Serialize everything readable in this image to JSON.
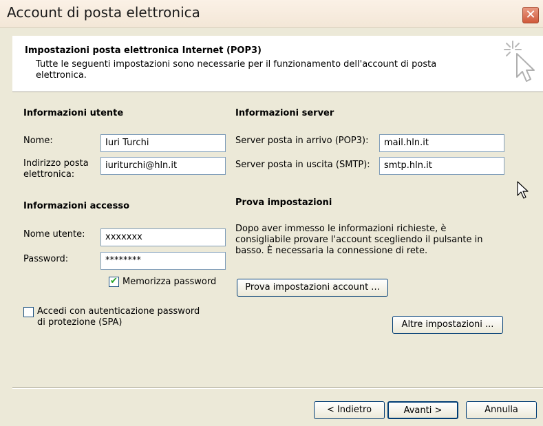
{
  "window": {
    "title": "Account di posta elettronica",
    "close_glyph": "✕"
  },
  "header": {
    "title": "Impostazioni posta elettronica Internet (POP3)",
    "description": "Tutte le seguenti impostazioni sono necessarie per il funzionamento dell'account di posta elettronica.",
    "icon": "wizard-cursor-icon"
  },
  "user_info": {
    "section_title": "Informazioni utente",
    "name_label": "Nome:",
    "name_value": "Iuri Turchi",
    "email_label": "Indirizzo posta elettronica:",
    "email_value": "iuriturchi@hln.it"
  },
  "server_info": {
    "section_title": "Informazioni server",
    "incoming_label": "Server posta in arrivo (POP3):",
    "incoming_value": "mail.hln.it",
    "outgoing_label": "Server posta in uscita (SMTP):",
    "outgoing_value": "smtp.hln.it"
  },
  "login_info": {
    "section_title": "Informazioni accesso",
    "username_label": "Nome utente:",
    "username_value": "xxxxxxx",
    "password_label": "Password:",
    "password_value": "********",
    "remember_label": "Memorizza password",
    "remember_checked": true,
    "spa_label": "Accedi con autenticazione password di protezione (SPA)",
    "spa_checked": false
  },
  "test_settings": {
    "section_title": "Prova impostazioni",
    "description": "Dopo aver immesso le informazioni richieste, è consigliabile provare l'account scegliendo il pulsante in basso. È necessaria la connessione di rete.",
    "test_button": "Prova impostazioni account ...",
    "more_button": "Altre impostazioni ..."
  },
  "footer": {
    "back_button": "< Indietro",
    "next_button": "Avanti >",
    "cancel_button": "Annulla"
  },
  "colors": {
    "accent_check": "#21a121",
    "close_button": "#d0583a",
    "dialog_bg": "#ece9d8"
  }
}
